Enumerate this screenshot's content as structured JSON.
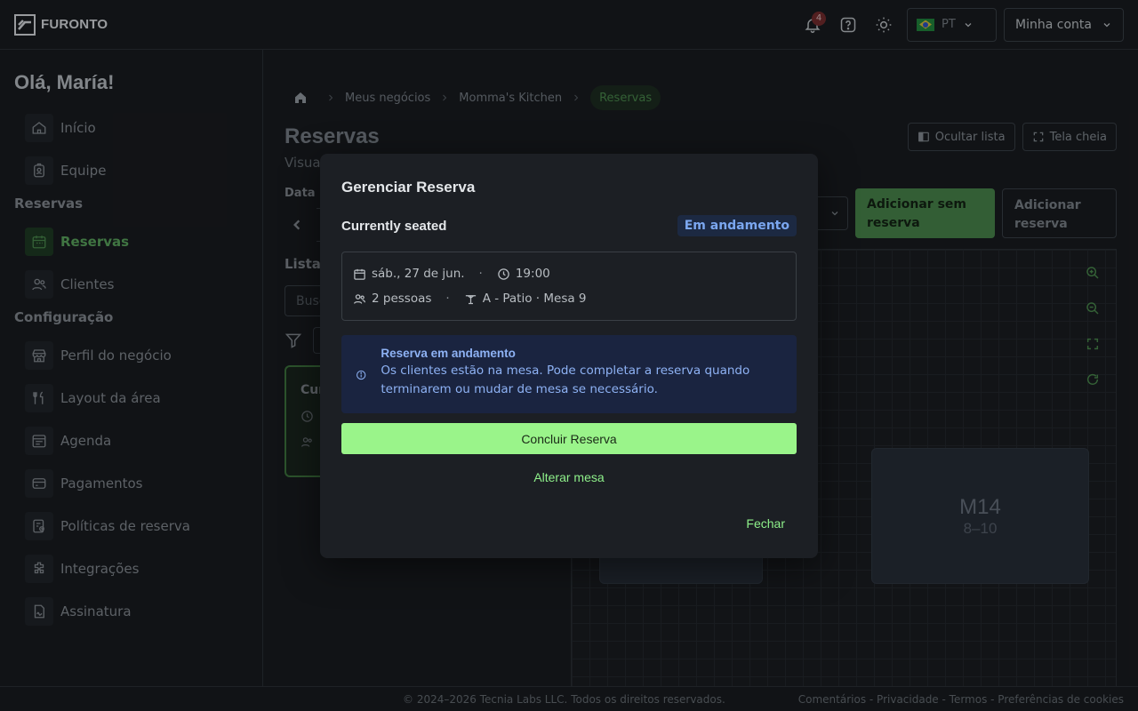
{
  "app": {
    "logo_text": "FURONTO"
  },
  "topbar": {
    "notifications_count": "4",
    "language_code": "PT",
    "account_label": "Minha conta"
  },
  "sidebar": {
    "greeting": "Olá, María!",
    "items_top": [
      {
        "label": "Início",
        "icon": "home-icon"
      },
      {
        "label": "Equipe",
        "icon": "badge-icon"
      }
    ],
    "section_reservas": "Reservas",
    "items_reservas": [
      {
        "label": "Reservas",
        "icon": "calendar-icon",
        "active": true
      },
      {
        "label": "Clientes",
        "icon": "users-icon"
      }
    ],
    "section_config": "Configuração",
    "items_config": [
      {
        "label": "Perfil do negócio",
        "icon": "store-icon"
      },
      {
        "label": "Layout da área",
        "icon": "utensils-icon"
      },
      {
        "label": "Agenda",
        "icon": "calendar-lines-icon"
      },
      {
        "label": "Pagamentos",
        "icon": "wallet-icon"
      },
      {
        "label": "Políticas de reserva",
        "icon": "policy-icon"
      },
      {
        "label": "Integrações",
        "icon": "puzzle-icon"
      },
      {
        "label": "Assinatura",
        "icon": "signature-icon"
      }
    ]
  },
  "breadcrumb": {
    "items": [
      "Meus negócios",
      "Momma's Kitchen"
    ],
    "current": "Reservas"
  },
  "page": {
    "title": "Reservas",
    "subtitle_fragment": "Visua",
    "hide_list": "Ocultar lista",
    "fullscreen": "Tela cheia",
    "date_label": "Data",
    "add_no_reservation": "Adicionar sem reserva",
    "add_reservation": "Adicionar reserva",
    "list_label_fragment": "Lista",
    "search_placeholder_fragment": "Busc",
    "card_title_fragment": "Cur"
  },
  "map": {
    "table": {
      "name": "M14",
      "capacity": "8–10"
    }
  },
  "modal": {
    "title": "Gerenciar Reserva",
    "status_text": "Currently seated",
    "status_pill": "Em andamento",
    "date": "sáb., 27 de jun.",
    "time": "19:00",
    "guests": "2 pessoas",
    "table": "A - Patio · Mesa 9",
    "alert_title": "Reserva em andamento",
    "alert_text": "Os clientes estão na mesa. Pode completar a reserva quando terminarem ou mudar de mesa se necessário.",
    "primary_action": "Concluir Reserva",
    "secondary_action": "Alterar mesa",
    "close": "Fechar"
  },
  "footer": {
    "copyright": "© 2024–2026 Tecnia Labs LLC. Todos os direitos reservados.",
    "links": "Comentários - Privacidade - Termos - Preferências de cookies"
  },
  "colors": {
    "accent_green": "#9af48a",
    "status_blue": "#7ba7f0",
    "background": "#16181b"
  }
}
